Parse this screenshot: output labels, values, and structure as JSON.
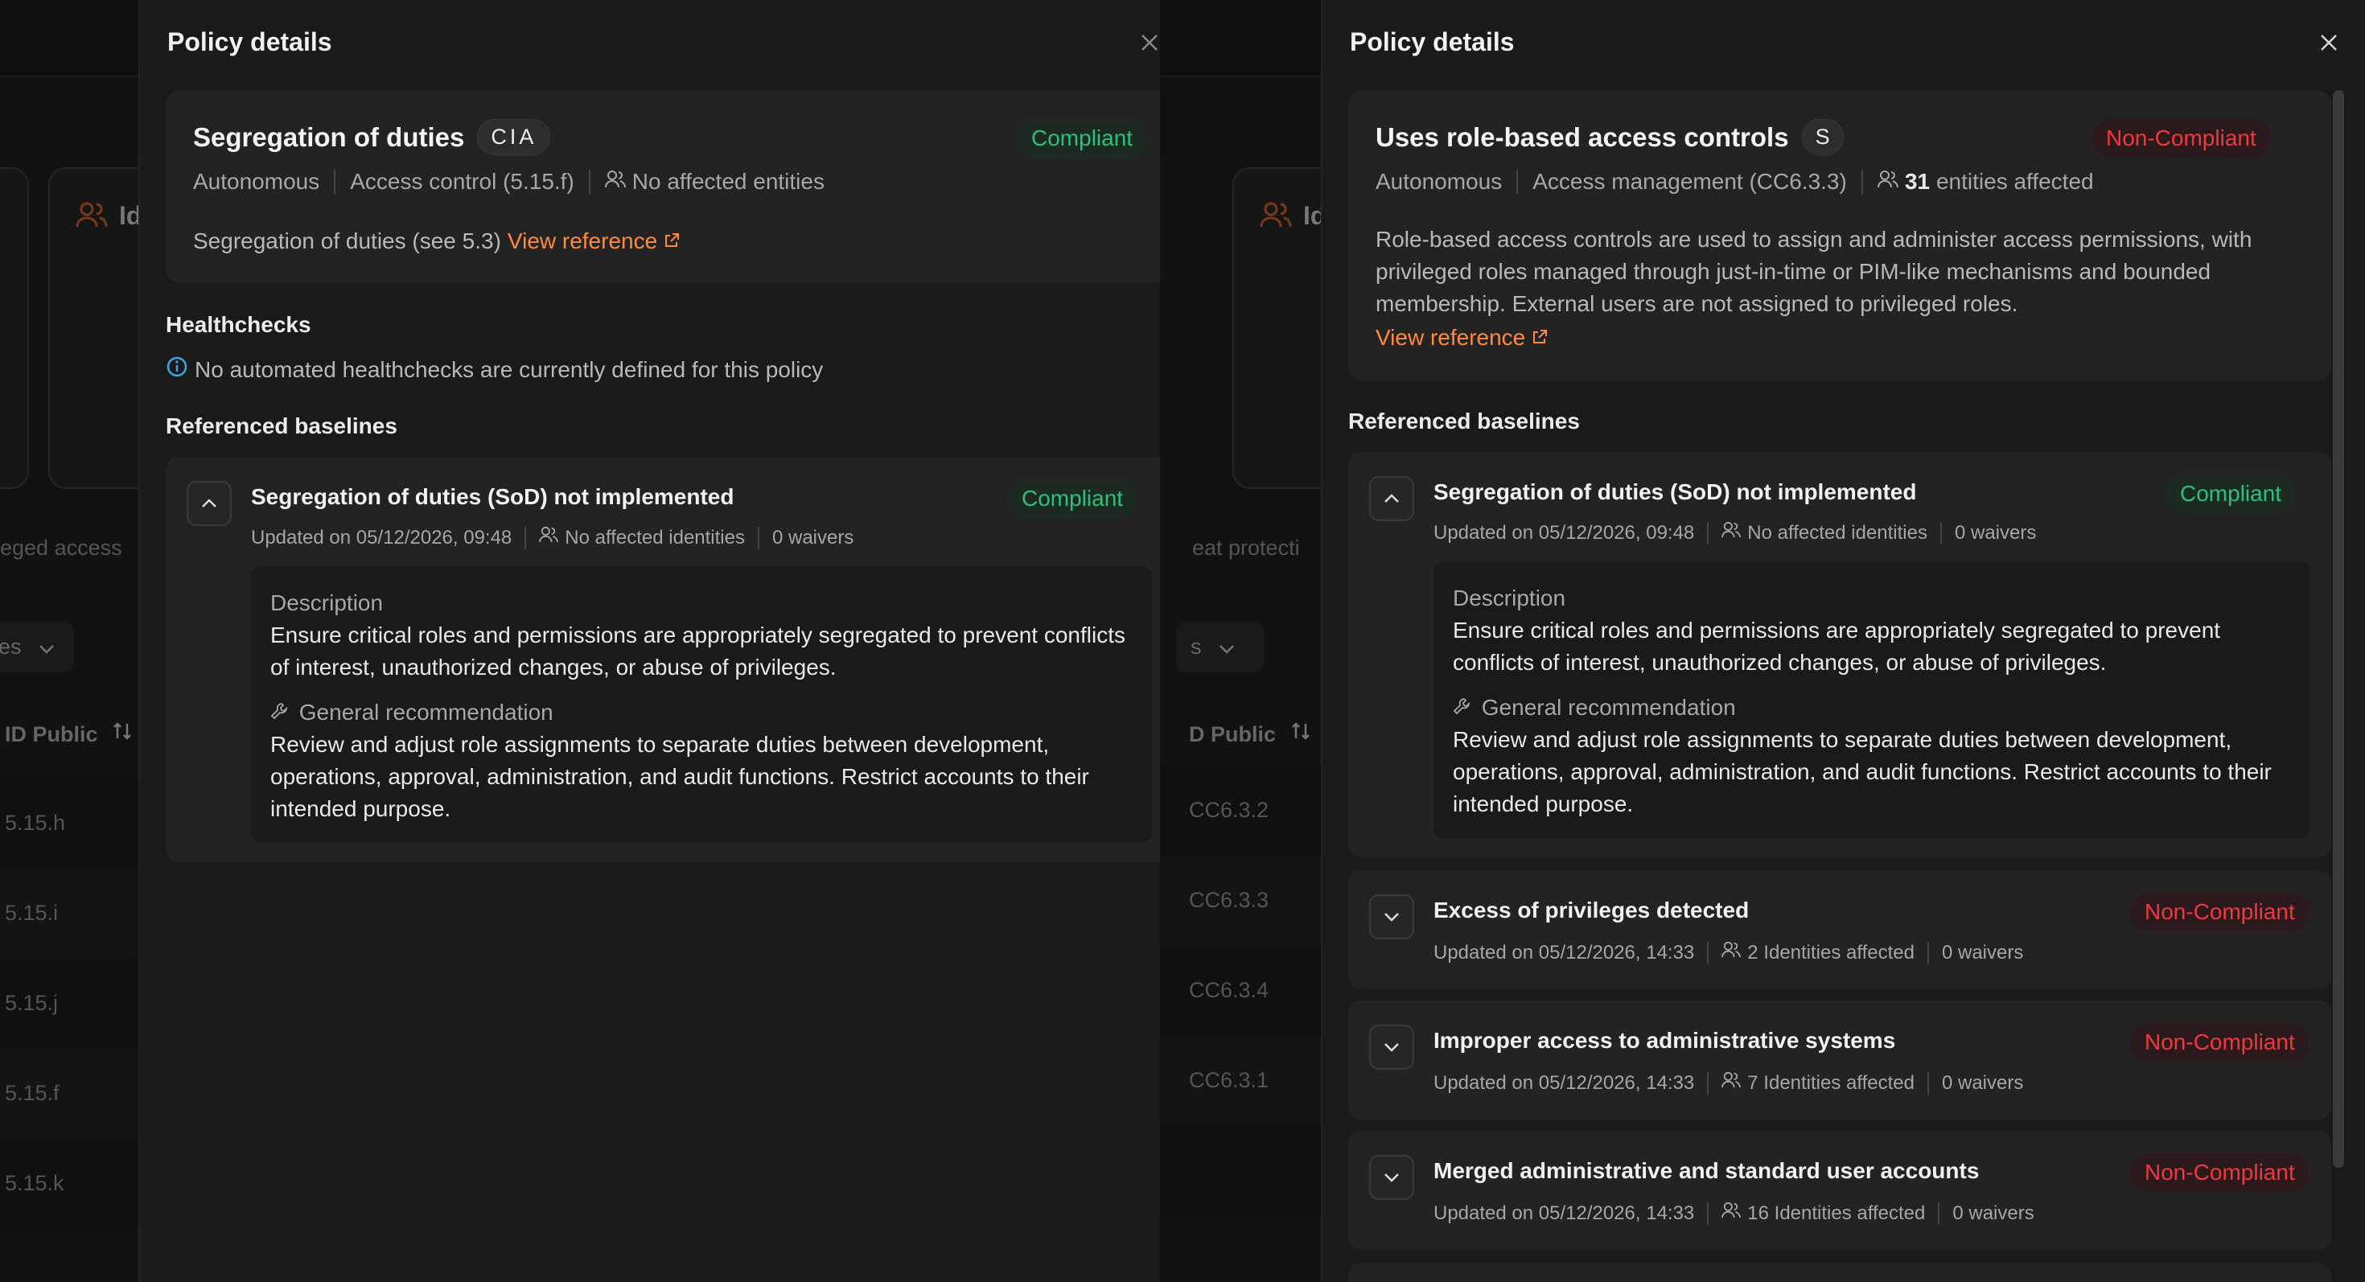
{
  "background_left": {
    "card_label": "Id",
    "row_text": "eged access",
    "filter_label": "es",
    "column_header": "ID Public",
    "rows": [
      "5.15.h",
      "5.15.i",
      "5.15.j",
      "5.15.f",
      "5.15.k"
    ]
  },
  "background_right": {
    "card_label": "Id",
    "row_text": "eat protecti",
    "filter_label": "s",
    "column_header": "D Public",
    "rows": [
      "CC6.3.2",
      "CC6.3.3",
      "CC6.3.4",
      "CC6.3.1"
    ]
  },
  "panel_left": {
    "title": "Policy details",
    "policy": {
      "name": "Segregation of duties",
      "tag": "CIA",
      "status": "Compliant",
      "mode": "Autonomous",
      "control": "Access control (5.15.f)",
      "affected": "No affected entities",
      "description": "Segregation of duties (see 5.3)",
      "link": "View reference"
    },
    "healthchecks_title": "Healthchecks",
    "healthchecks_note": "No automated healthchecks are currently defined for this policy",
    "baselines_title": "Referenced baselines",
    "baselines": [
      {
        "title": "Segregation of duties (SoD) not implemented",
        "status": "Compliant",
        "updated": "Updated on 05/12/2026, 09:48",
        "identities": "No affected identities",
        "waivers": "0 waivers",
        "description_label": "Description",
        "description": "Ensure critical roles and permissions are appropriately segregated to prevent conflicts of interest, unauthorized changes, or abuse of privileges.",
        "recommendation_label": "General recommendation",
        "recommendation": "Review and adjust role assignments to separate duties between development, operations, approval, administration, and audit functions. Restrict accounts to their intended purpose."
      }
    ]
  },
  "panel_right": {
    "title": "Policy details",
    "policy": {
      "name": "Uses role-based access controls",
      "tag": "S",
      "status": "Non-Compliant",
      "mode": "Autonomous",
      "control": "Access management (CC6.3.3)",
      "affected_count": "31",
      "affected_suffix": "entities affected",
      "description": "Role-based access controls are used to assign and administer access permissions, with privileged roles managed through just-in-time or PIM-like mechanisms and bounded membership. External users are not assigned to privileged roles.",
      "link": "View reference"
    },
    "baselines_title": "Referenced baselines",
    "baselines": [
      {
        "title": "Segregation of duties (SoD) not implemented",
        "status": "Compliant",
        "updated": "Updated on 05/12/2026, 09:48",
        "identities": "No affected identities",
        "waivers": "0 waivers",
        "description_label": "Description",
        "description": "Ensure critical roles and permissions are appropriately segregated to prevent conflicts of interest, unauthorized changes, or abuse of privileges.",
        "recommendation_label": "General recommendation",
        "recommendation": "Review and adjust role assignments to separate duties between development, operations, approval, administration, and audit functions. Restrict accounts to their intended purpose."
      },
      {
        "title": "Excess of privileges detected",
        "status": "Non-Compliant",
        "updated": "Updated on 05/12/2026, 14:33",
        "identities": "2 Identities affected",
        "waivers": "0 waivers"
      },
      {
        "title": "Improper access to administrative systems",
        "status": "Non-Compliant",
        "updated": "Updated on 05/12/2026, 14:33",
        "identities": "7 Identities affected",
        "waivers": "0 waivers"
      },
      {
        "title": "Merged administrative and standard user accounts",
        "status": "Non-Compliant",
        "updated": "Updated on 05/12/2026, 14:33",
        "identities": "16 Identities affected",
        "waivers": "0 waivers"
      }
    ]
  },
  "icons": {
    "close": "close-icon",
    "users": "users-icon",
    "external": "external-link-icon",
    "info": "info-icon",
    "wrench": "wrench-icon",
    "chevron_up": "chevron-up-icon",
    "chevron_down": "chevron-down-icon",
    "sort": "sort-icon"
  },
  "colors": {
    "compliant": "#2dc07c",
    "non_compliant": "#f3373f",
    "link": "#ff8a3d",
    "info": "#3fa7e0"
  }
}
